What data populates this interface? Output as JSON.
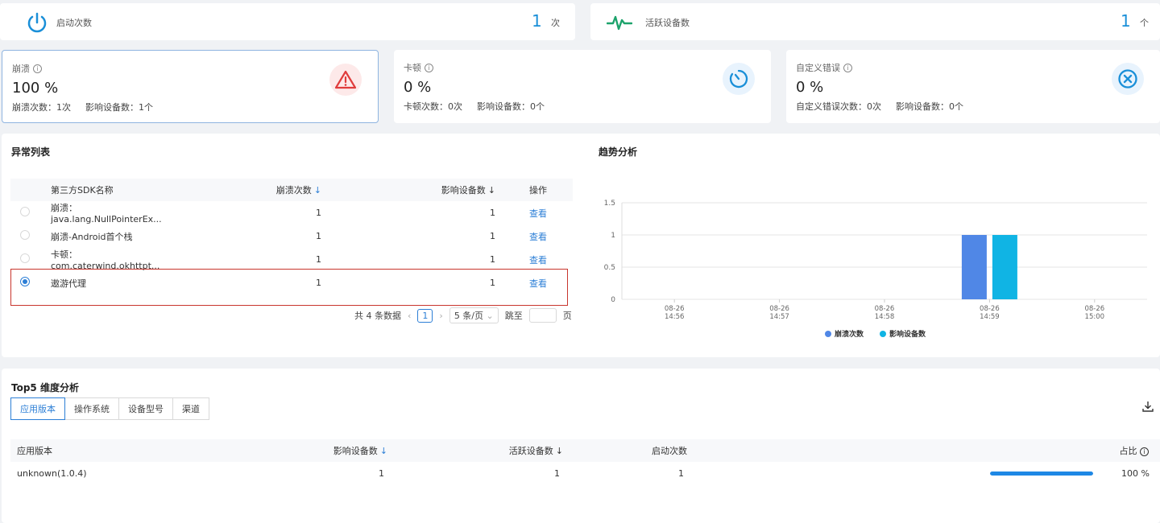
{
  "top_stats": {
    "launches": {
      "label": "启动次数",
      "value": "1",
      "unit": "次",
      "icon": "power-icon"
    },
    "active": {
      "label": "活跃设备数",
      "value": "1",
      "unit": "个",
      "icon": "pulse-icon"
    }
  },
  "metrics": [
    {
      "title": "崩溃",
      "value": "100 %",
      "count_label": "崩溃次数：",
      "count": "1次",
      "device_label": "影响设备数：",
      "devices": "1个",
      "icon": "warning-icon"
    },
    {
      "title": "卡顿",
      "value": "0 %",
      "count_label": "卡顿次数：",
      "count": "0次",
      "device_label": "影响设备数：",
      "devices": "0个",
      "icon": "timer-icon"
    },
    {
      "title": "自定义错误",
      "value": "0 %",
      "count_label": "自定义错误次数：",
      "count": "0次",
      "device_label": "影响设备数：",
      "devices": "0个",
      "icon": "close-circle-icon"
    }
  ],
  "exceptions": {
    "title": "异常列表",
    "headers": {
      "name": "第三方SDK名称",
      "crashes": "崩溃次数",
      "devices": "影响设备数",
      "action": "操作"
    },
    "rows": [
      {
        "name": "崩溃：java.lang.NullPointerEx...",
        "crashes": "1",
        "devices": "1",
        "action": "查看",
        "selected": false
      },
      {
        "name": "崩溃-Android首个栈",
        "crashes": "1",
        "devices": "1",
        "action": "查看",
        "selected": false
      },
      {
        "name": "卡顿：com.caterwind.okhttpt...",
        "crashes": "1",
        "devices": "1",
        "action": "查看",
        "selected": false
      },
      {
        "name": "遨游代理",
        "crashes": "1",
        "devices": "1",
        "action": "查看",
        "selected": true
      }
    ],
    "pager": {
      "total": "共 4 条数据",
      "prev": "‹",
      "current": "1",
      "next": "›",
      "size": "5 条/页",
      "goto": "跳至",
      "page": "页"
    }
  },
  "trend": {
    "title": "趋势分析"
  },
  "chart_data": {
    "type": "bar",
    "categories": [
      "08-26 14:56",
      "08-26 14:57",
      "08-26 14:58",
      "08-26 14:59",
      "08-26 15:00"
    ],
    "category_lines": [
      [
        "08-26",
        "14:56"
      ],
      [
        "08-26",
        "14:57"
      ],
      [
        "08-26",
        "14:58"
      ],
      [
        "08-26",
        "14:59"
      ],
      [
        "08-26",
        "15:00"
      ]
    ],
    "series": [
      {
        "name": "崩溃次数",
        "values": [
          0,
          0,
          0,
          1,
          0
        ],
        "color": "#5087e6"
      },
      {
        "name": "影响设备数",
        "values": [
          0,
          0,
          0,
          1,
          0
        ],
        "color": "#10b4e4"
      }
    ],
    "ylim": [
      0,
      1.5
    ],
    "yticks": [
      "0",
      "0.5",
      "1",
      "1.5"
    ],
    "grid": true,
    "legend": "bottom"
  },
  "top5": {
    "title": "Top5 维度分析",
    "tabs": [
      "应用版本",
      "操作系统",
      "设备型号",
      "渠道"
    ],
    "headers": {
      "version": "应用版本",
      "devices": "影响设备数",
      "active": "活跃设备数",
      "launches": "启动次数",
      "ratio": "占比"
    },
    "rows": [
      {
        "version": "unknown(1.0.4)",
        "devices": "1",
        "active": "1",
        "launches": "1",
        "ratio": "100 %",
        "ratio_value": 100
      }
    ]
  },
  "colors": {
    "accent": "#2d7fd6",
    "crash": "#e03c3c",
    "highlight": "#c8352d"
  }
}
